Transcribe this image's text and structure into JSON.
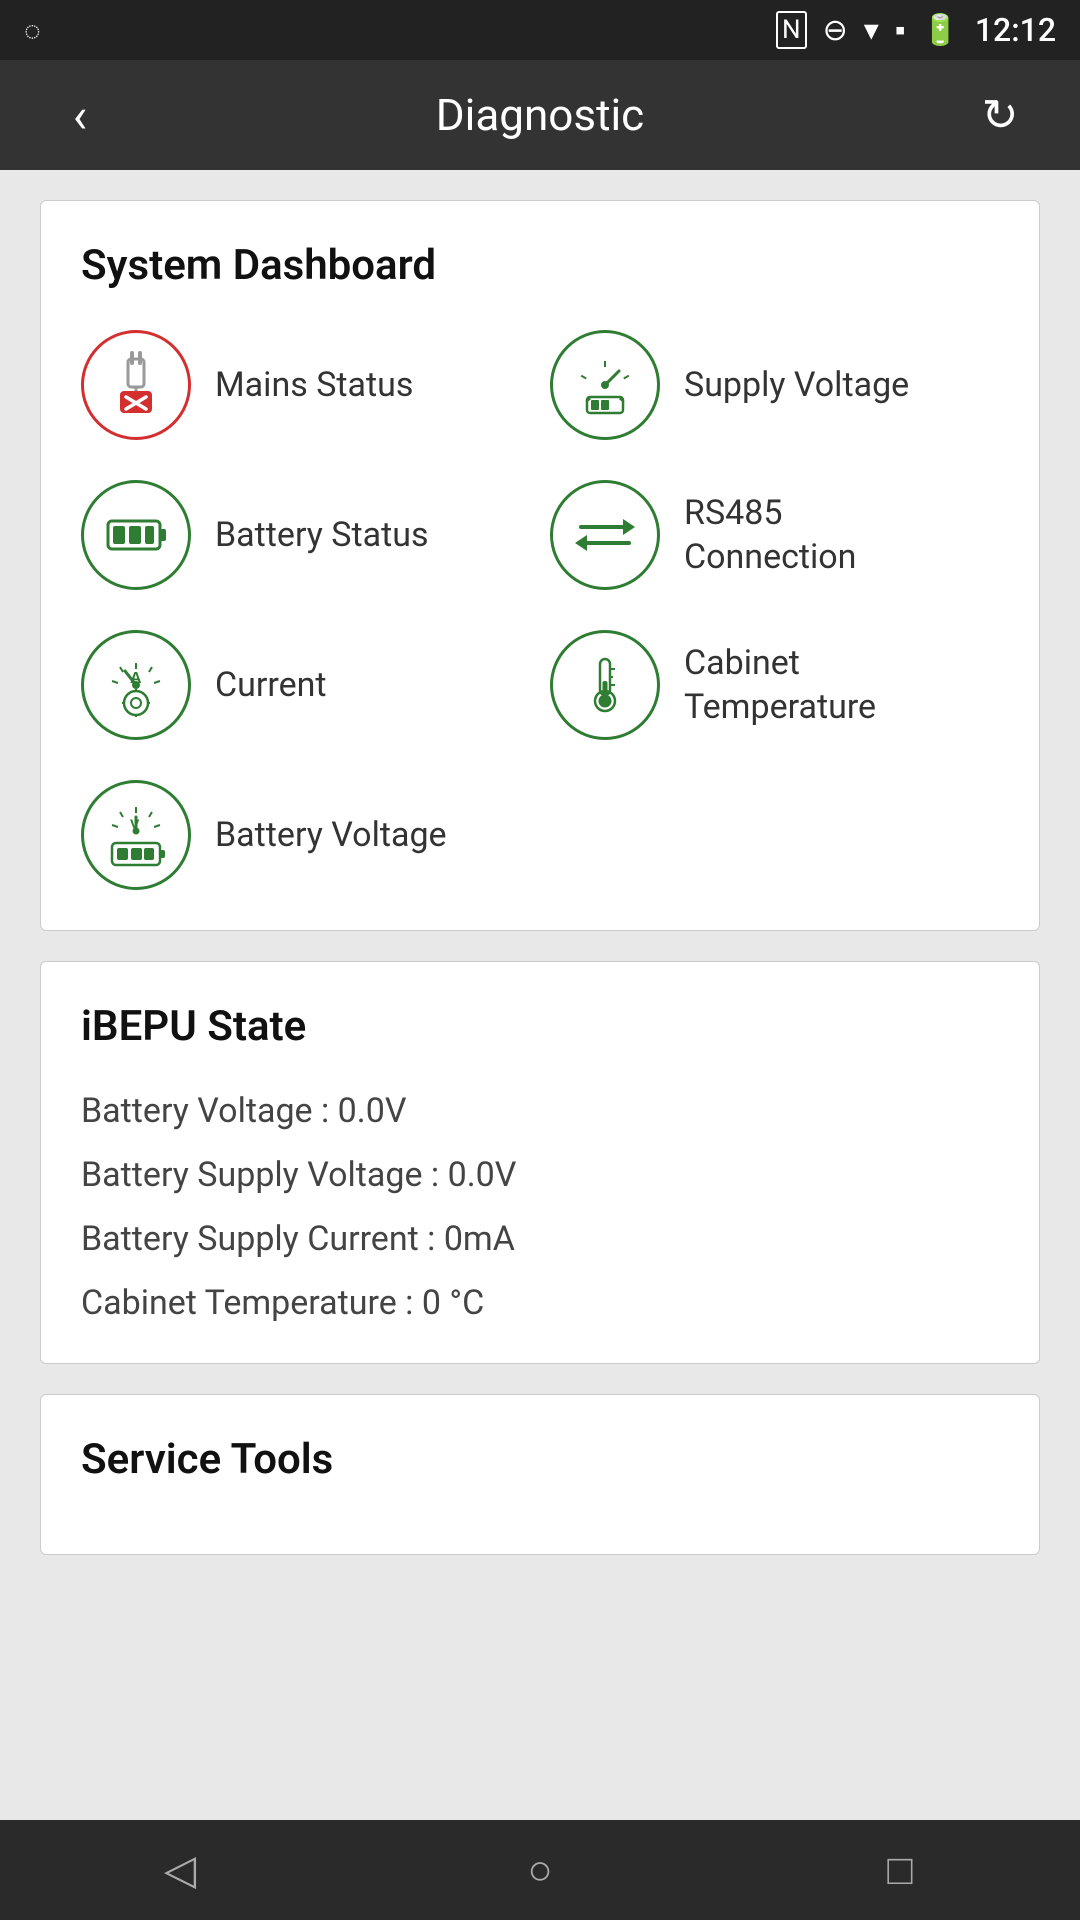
{
  "statusBar": {
    "time": "12:12"
  },
  "topNav": {
    "backLabel": "‹",
    "title": "Diagnostic",
    "refreshLabel": "↻"
  },
  "systemDashboard": {
    "title": "System Dashboard",
    "items": [
      {
        "id": "mains-status",
        "label": "Mains Status",
        "iconType": "mains",
        "redBorder": true
      },
      {
        "id": "supply-voltage",
        "label": "Supply Voltage",
        "iconType": "supply-voltage",
        "redBorder": false
      },
      {
        "id": "battery-status",
        "label": "Battery Status",
        "iconType": "battery",
        "redBorder": false
      },
      {
        "id": "rs485-connection",
        "label": "RS485\nConnection",
        "iconType": "rs485",
        "redBorder": false
      },
      {
        "id": "current",
        "label": "Current",
        "iconType": "current",
        "redBorder": false
      },
      {
        "id": "cabinet-temperature",
        "label": "Cabinet\nTemperature",
        "iconType": "temperature",
        "redBorder": false
      },
      {
        "id": "battery-voltage",
        "label": "Battery Voltage",
        "iconType": "battery-voltage",
        "redBorder": false
      }
    ]
  },
  "ibepu": {
    "title": "iBEPU State",
    "rows": [
      {
        "label": "Battery Voltage : 0.0V"
      },
      {
        "label": "Battery Supply Voltage : 0.0V"
      },
      {
        "label": "Battery Supply Current : 0mA"
      },
      {
        "label": "Cabinet Temperature : 0 °C"
      }
    ]
  },
  "serviceTools": {
    "title": "Service Tools"
  },
  "bottomNav": {
    "back": "◁",
    "home": "○",
    "recent": "□"
  }
}
